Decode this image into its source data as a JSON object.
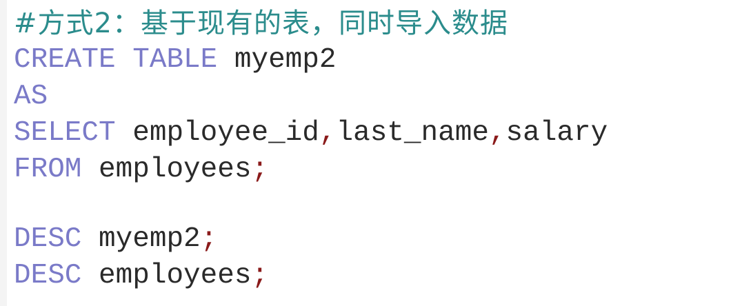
{
  "comment": "#方式2：基于现有的表，同时导入数据",
  "lines": {
    "l1": {
      "kw1": "CREATE",
      "kw2": "TABLE",
      "name": "myemp2"
    },
    "l2": {
      "kw": "AS"
    },
    "l3": {
      "kw": "SELECT",
      "c1": "employee_id",
      "sep1": ",",
      "c2": "last_name",
      "sep2": ",",
      "c3": "salary"
    },
    "l4": {
      "kw": "FROM",
      "table": "employees",
      "end": ";"
    },
    "l5": {
      "kw": "DESC",
      "table": "myemp2",
      "end": ";"
    },
    "l6": {
      "kw": "DESC",
      "table": "employees",
      "end": ";"
    }
  },
  "colors": {
    "comment": "#2b8c8c",
    "keyword": "#7a7ac8",
    "identifier": "#2a2a2a",
    "punctuation": "#8a1a1a"
  }
}
